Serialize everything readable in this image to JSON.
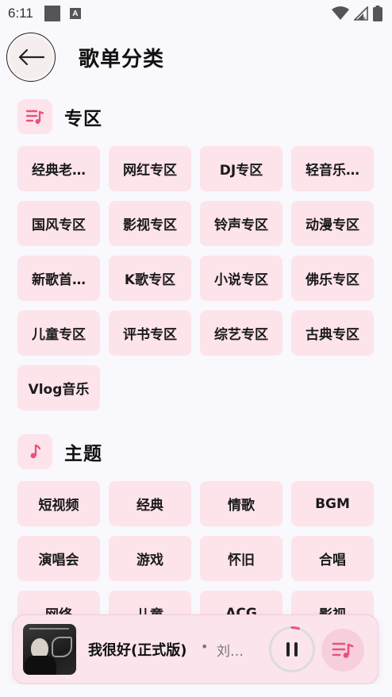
{
  "status_bar": {
    "time": "6:11",
    "a_badge": "A"
  },
  "header": {
    "title": "歌单分类",
    "back_icon": "arrow-left-icon"
  },
  "sections": [
    {
      "title": "专区",
      "icon": "playlist-music-icon",
      "items": [
        "经典老…",
        "网红专区",
        "DJ专区",
        "轻音乐…",
        "国风专区",
        "影视专区",
        "铃声专区",
        "动漫专区",
        "新歌首…",
        "K歌专区",
        "小说专区",
        "佛乐专区",
        "儿童专区",
        "评书专区",
        "综艺专区",
        "古典专区",
        "Vlog音乐"
      ]
    },
    {
      "title": "主题",
      "icon": "music-note-icon",
      "items": [
        "短视频",
        "经典",
        "情歌",
        "BGM",
        "演唱会",
        "游戏",
        "怀旧",
        "合唱",
        "网络",
        "儿童",
        "ACG",
        "影视"
      ]
    }
  ],
  "player": {
    "song": "我很好(正式版)",
    "separator": "•",
    "artist": "刘…",
    "state": "playing",
    "progress": 0.05
  },
  "colors": {
    "accent": "#e8527e",
    "chip_bg": "#fde3ea",
    "player_bg": "#fbe4ec"
  }
}
